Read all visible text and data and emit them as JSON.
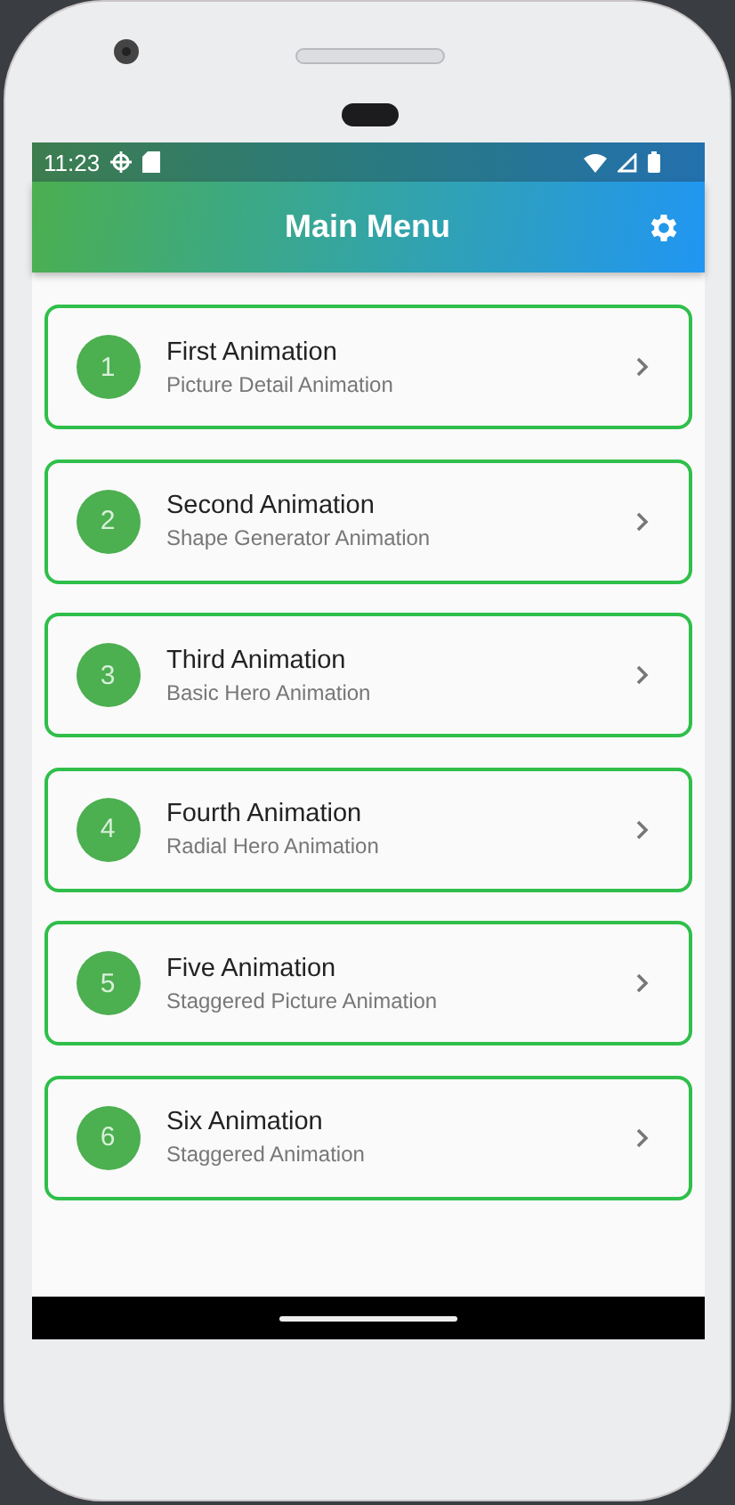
{
  "status_bar": {
    "time": "11:23"
  },
  "app_bar": {
    "title": "Main Menu"
  },
  "items": [
    {
      "number": "1",
      "title": "First Animation",
      "subtitle": "Picture Detail Animation"
    },
    {
      "number": "2",
      "title": "Second Animation",
      "subtitle": "Shape Generator Animation"
    },
    {
      "number": "3",
      "title": "Third Animation",
      "subtitle": "Basic Hero Animation"
    },
    {
      "number": "4",
      "title": "Fourth Animation",
      "subtitle": "Radial Hero Animation"
    },
    {
      "number": "5",
      "title": "Five Animation",
      "subtitle": "Staggered Picture Animation"
    },
    {
      "number": "6",
      "title": "Six Animation",
      "subtitle": "Staggered Animation"
    }
  ]
}
